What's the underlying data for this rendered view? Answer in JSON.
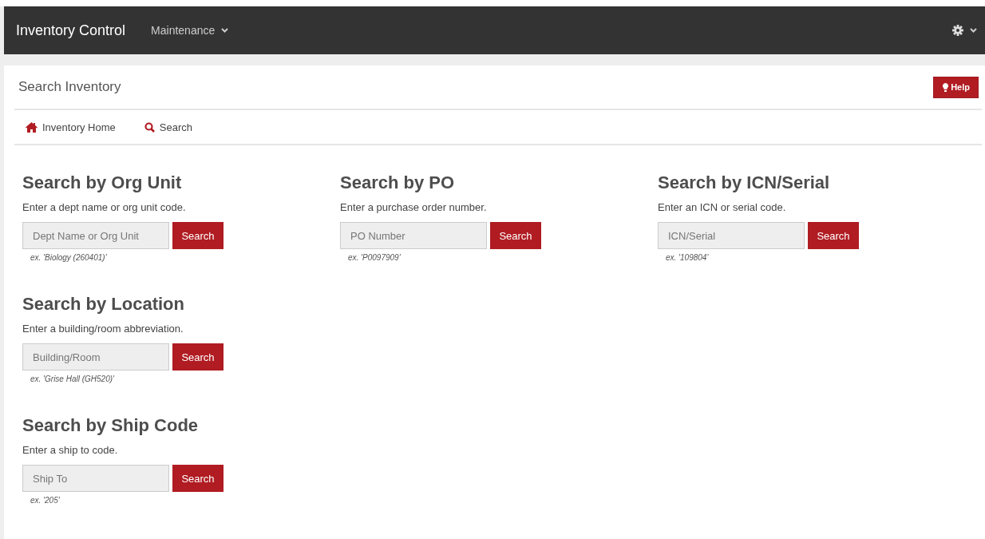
{
  "navbar": {
    "brand": "Inventory Control",
    "menus": [
      {
        "label": "Maintenance"
      }
    ]
  },
  "page": {
    "title": "Search Inventory",
    "help_button": "Help"
  },
  "links": [
    {
      "label": "Inventory Home",
      "kind": "home"
    },
    {
      "label": "Search",
      "kind": "search"
    }
  ],
  "rows": [
    [
      {
        "heading": "Search by Org Unit",
        "description": "Enter a dept name or org unit code.",
        "placeholder": "Dept Name or Org Unit",
        "button": "Search",
        "example": "ex. 'Biology (260401)'"
      },
      {
        "heading": "Search by PO",
        "description": "Enter a purchase order number.",
        "placeholder": "PO Number",
        "button": "Search",
        "example": "ex. 'P0097909'"
      },
      {
        "heading": "Search by ICN/Serial",
        "description": "Enter an ICN or serial code.",
        "placeholder": "ICN/Serial",
        "button": "Search",
        "example": "ex. '109804'"
      }
    ],
    [
      {
        "heading": "Search by Location",
        "description": "Enter a building/room abbreviation.",
        "placeholder": "Building/Room",
        "button": "Search",
        "example": "ex. 'Grise Hall (GH520)'"
      }
    ],
    [
      {
        "heading": "Search by Ship Code",
        "description": "Enter a ship to code.",
        "placeholder": "Ship To",
        "button": "Search",
        "example": "ex. '205'"
      }
    ]
  ]
}
